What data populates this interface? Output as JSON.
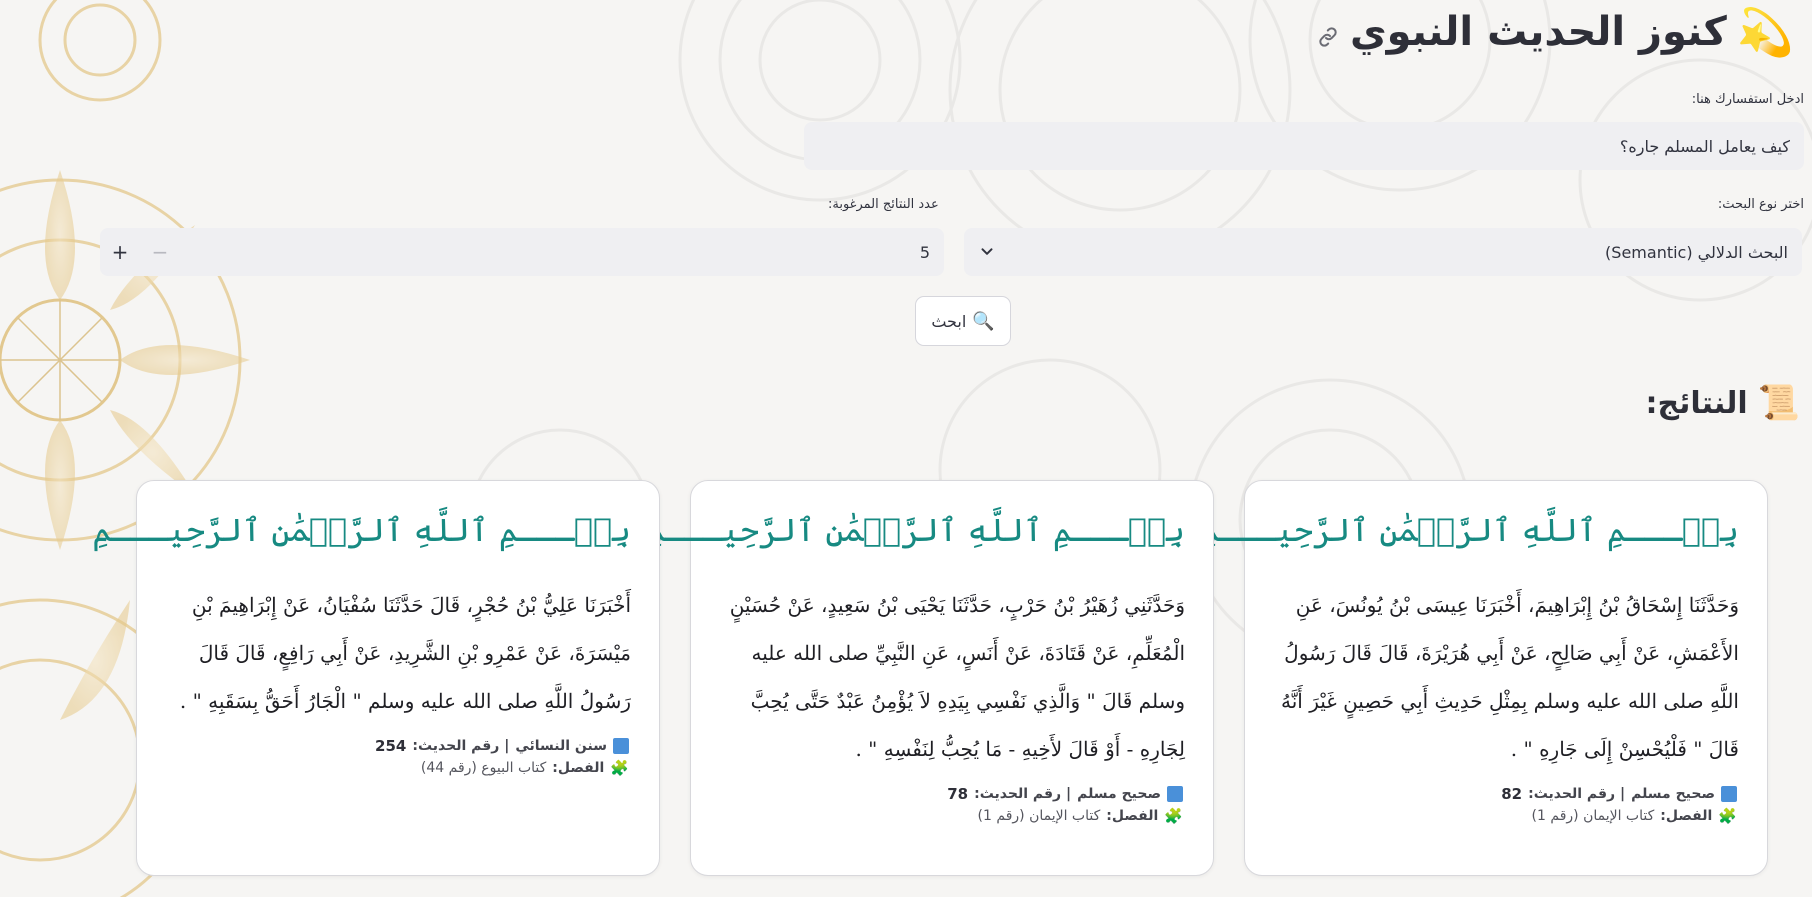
{
  "app": {
    "title": "كنوز الحديث النبوي",
    "title_icon": "shooting-star-emoji"
  },
  "query": {
    "label": "ادخل استفسارك هنا:",
    "value": "كيف يعامل المسلم جاره؟"
  },
  "search_type": {
    "label": "اختر نوع البحث:",
    "selected": "البحث الدلالي (Semantic)"
  },
  "result_count": {
    "label": "عدد النتائج المرغوبة:",
    "value": "5",
    "plus": "+",
    "minus": "−"
  },
  "search_button": {
    "label": "ابحث",
    "icon": "🔍"
  },
  "results": {
    "header": "النتائج:",
    "icon": "📜",
    "basmala": "بِسۡـــمِ ٱللَّهِ ٱلرَّحۡمَٰنِ ٱلرَّحِيـــمِ",
    "source_sep": " | رقم الحديث: ",
    "chapter_label": "الفصل:",
    "items": [
      {
        "text": "وَحَدَّثَنَا إِسْحَاقُ بْنُ إِبْرَاهِيمَ، أَخْبَرَنَا عِيسَى بْنُ يُونُسَ، عَنِ الأَعْمَشِ، عَنْ أَبِي صَالِحٍ، عَنْ أَبِي هُرَيْرَةَ، قَالَ قَالَ رَسُولُ اللَّهِ صلى الله عليه وسلم بِمِثْلِ حَدِيثِ أَبِي حَصِينٍ غَيْرَ أَنَّهُ قَالَ \" فَلْيُحْسِنْ إِلَى جَارِهِ \" .",
        "source": "صحيح مسلم",
        "number": "82",
        "chapter": "كتاب الإيمان (رقم 1)"
      },
      {
        "text": "وَحَدَّثَنِي زُهَيْرُ بْنُ حَرْبٍ، حَدَّثَنَا يَحْيَى بْنُ سَعِيدٍ، عَنْ حُسَيْنٍ الْمُعَلِّمِ، عَنْ قَتَادَةَ، عَنْ أَنَسٍ، عَنِ النَّبِيِّ صلى الله عليه وسلم قَالَ \" وَالَّذِي نَفْسِي بِيَدِهِ لاَ يُؤْمِنُ عَبْدٌ حَتَّى يُحِبَّ لِجَارِهِ - أَوْ قَالَ لأَخِيهِ - مَا يُحِبُّ لِنَفْسِهِ \" .",
        "source": "صحيح مسلم",
        "number": "78",
        "chapter": "كتاب الإيمان (رقم 1)"
      },
      {
        "text": "أَخْبَرَنَا عَلِيُّ بْنُ حُجْرٍ، قَالَ حَدَّثَنَا سُفْيَانُ، عَنْ إِبْرَاهِيمَ بْنِ مَيْسَرَةَ، عَنْ عَمْرِو بْنِ الشَّرِيدِ، عَنْ أَبِي رَافِعٍ، قَالَ قَالَ رَسُولُ اللَّهِ صلى الله عليه وسلم \" الْجَارُ أَحَقُّ بِسَقَبِهِ \" .",
        "source": "سنن النسائي",
        "number": "254",
        "chapter": "كتاب البيوع (رقم 44)"
      }
    ]
  },
  "colors": {
    "basmala": "#178a82",
    "input_bg": "#efeff2",
    "background": "#f6f5f3"
  }
}
